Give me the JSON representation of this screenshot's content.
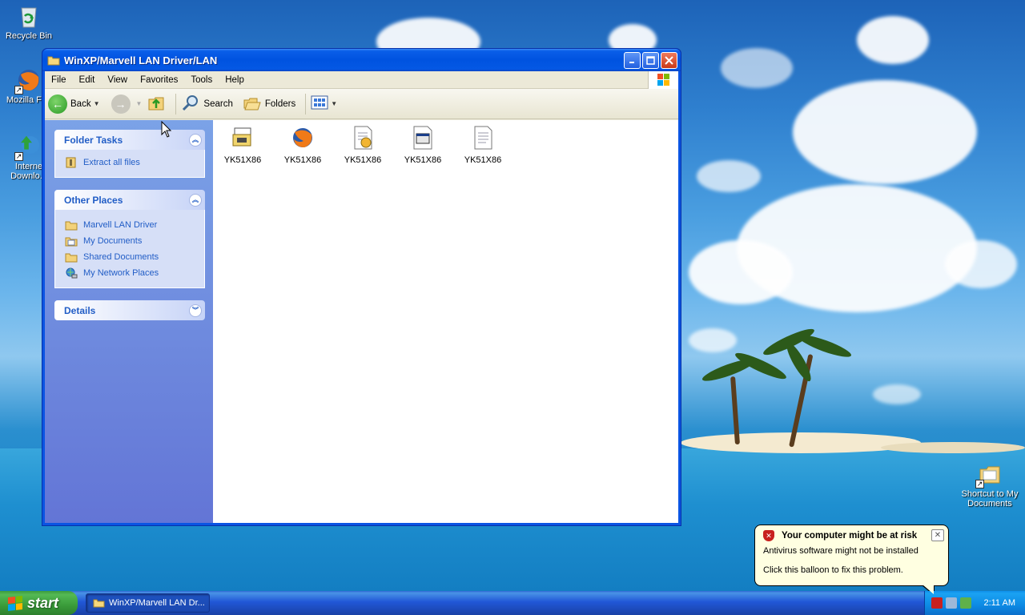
{
  "desktop": {
    "icons": [
      {
        "label": "Recycle Bin",
        "icon": "recycle-bin-icon"
      },
      {
        "label": "Mozilla Fire",
        "icon": "firefox-icon"
      },
      {
        "label": "Interne Downlo...",
        "icon": "internet-download-manager-icon"
      },
      {
        "label": "Shortcut to My Documents",
        "icon": "folder-shortcut-icon"
      }
    ]
  },
  "window": {
    "title": "WinXP/Marvell LAN Driver/LAN",
    "menu": [
      "File",
      "Edit",
      "View",
      "Favorites",
      "Tools",
      "Help"
    ],
    "toolbar": {
      "back_label": "Back",
      "search_label": "Search",
      "folders_label": "Folders"
    },
    "task_pane": {
      "folder_tasks": {
        "title": "Folder Tasks",
        "items": [
          {
            "label": "Extract all files",
            "icon": "extract-icon"
          }
        ]
      },
      "other_places": {
        "title": "Other Places",
        "items": [
          {
            "label": "Marvell LAN Driver",
            "icon": "folder-icon"
          },
          {
            "label": "My Documents",
            "icon": "my-documents-icon"
          },
          {
            "label": "Shared Documents",
            "icon": "folder-icon"
          },
          {
            "label": "My Network Places",
            "icon": "network-places-icon"
          }
        ]
      },
      "details": {
        "title": "Details"
      }
    },
    "files": [
      {
        "name": "YK51X86",
        "icon": "setup-package-icon"
      },
      {
        "name": "YK51X86",
        "icon": "firefox-document-icon"
      },
      {
        "name": "YK51X86",
        "icon": "setup-info-icon"
      },
      {
        "name": "YK51X86",
        "icon": "application-window-icon"
      },
      {
        "name": "YK51X86",
        "icon": "text-document-icon"
      }
    ]
  },
  "balloon": {
    "title": "Your computer might be at risk",
    "line1": "Antivirus software might not be installed",
    "line2": "Click this balloon to fix this problem."
  },
  "taskbar": {
    "start_label": "start",
    "task_button_label": "WinXP/Marvell LAN Dr...",
    "clock": "2:11 AM"
  },
  "colors": {
    "title_bar": "#0053e0",
    "task_pane": "#6f8ce0",
    "link": "#215dc6",
    "start_button": "#3a9c3a",
    "balloon": "#ffffe1"
  }
}
